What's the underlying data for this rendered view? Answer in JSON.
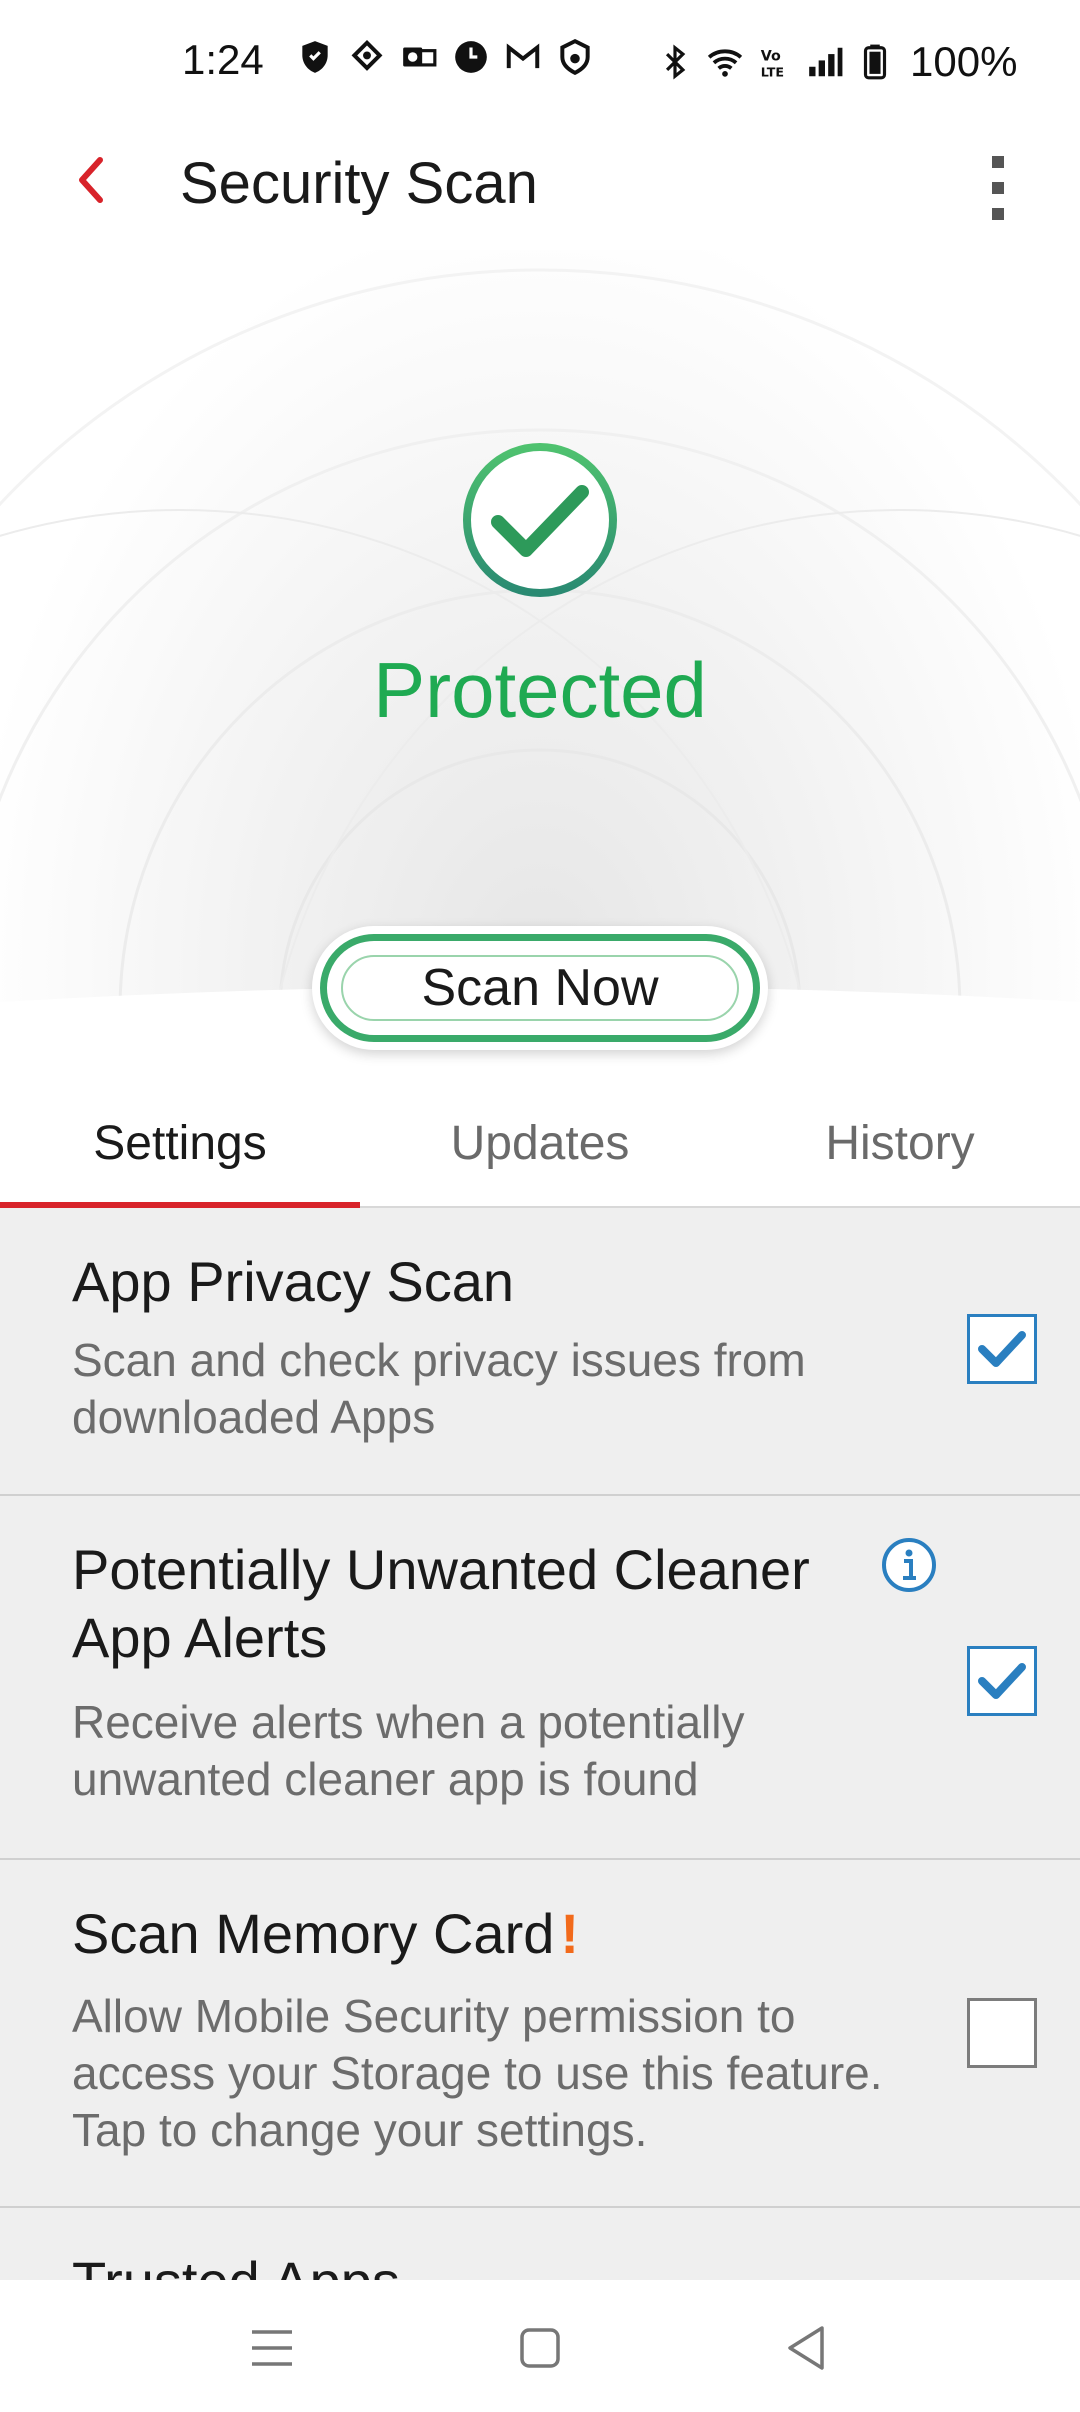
{
  "status_bar": {
    "time": "1:24",
    "battery": "100%",
    "left_icons": [
      "shield-icon",
      "sync-icon",
      "outlook-icon",
      "clock-icon",
      "gmail-icon",
      "vpn-icon"
    ],
    "right_icons": [
      "bluetooth-icon",
      "wifi-icon",
      "volte-icon",
      "signal-icon",
      "battery-icon"
    ]
  },
  "app_bar": {
    "title": "Security Scan",
    "back_icon": "chevron-left-icon",
    "menu_icon": "more-vertical-icon"
  },
  "hero": {
    "status_text": "Protected",
    "status_icon": "check-circle-icon",
    "scan_button_label": "Scan Now"
  },
  "tabs": [
    {
      "label": "Settings",
      "active": true
    },
    {
      "label": "Updates",
      "active": false
    },
    {
      "label": "History",
      "active": false
    }
  ],
  "settings": {
    "app_privacy": {
      "title": "App Privacy Scan",
      "desc_line1": "Scan and check privacy issues from",
      "desc_line2": "downloaded Apps",
      "checked": true
    },
    "cleaner_alerts": {
      "title_line1": "Potentially Unwanted Cleaner",
      "title_line2": "App Alerts",
      "desc_line1": "Receive alerts when a potentially",
      "desc_line2": "unwanted cleaner app is found",
      "checked": true,
      "info_icon": "info-icon"
    },
    "memory_card": {
      "title": "Scan Memory Card",
      "warning_mark": "!",
      "desc_line1": "Allow Mobile Security permission to",
      "desc_line2": "access your Storage to use this feature.",
      "desc_line3": "Tap to change your settings.",
      "checked": false
    },
    "trusted_apps": {
      "title": "Trusted Apps"
    }
  },
  "nav_bar": {
    "icons": [
      "menu-icon",
      "home-icon",
      "back-icon"
    ]
  },
  "colors": {
    "accent_red": "#d8232a",
    "protected_green": "#1faa52",
    "checkbox_blue": "#2a7fc0",
    "warning_orange": "#f26a1b"
  }
}
